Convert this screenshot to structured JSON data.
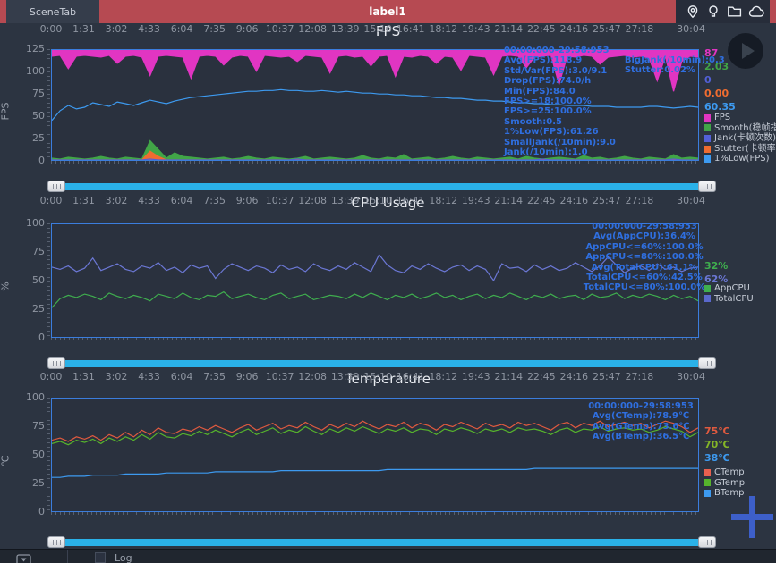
{
  "topbar": {
    "scene_tab": "SceneTab",
    "title": "label1",
    "accent_red": "#b64a52",
    "icons": [
      "location-icon",
      "bulb-icon",
      "folder-icon",
      "cloud-icon"
    ]
  },
  "bottombar": {
    "log_label": "Log"
  },
  "time_labels": [
    "0:00",
    "1:31",
    "3:02",
    "4:33",
    "6:04",
    "7:35",
    "9:06",
    "10:37",
    "12:08",
    "13:39",
    "15:10",
    "16:41",
    "18:12",
    "19:43",
    "21:14",
    "22:45",
    "24:16",
    "25:47",
    "27:18",
    "30:04"
  ],
  "charts": [
    {
      "title": "FPS",
      "unit": "FPS",
      "yticks": [
        "125",
        "100",
        "75",
        "50",
        "25",
        "0"
      ],
      "stats_col1": [
        "00:00:000-29:58:953",
        "Avg(FPS):118.9",
        "Std/Var(FPS):3.0/9.1",
        "Drop(FPS):74.0/h",
        "Min(FPS):84.0",
        "FPS>=18:100.0%",
        "FPS>=25:100.0%",
        "Smooth:0.5",
        "1%Low(FPS):61.26",
        "SmallJank(/10min):9.0",
        "Jank(/10min):1.0"
      ],
      "stats_col2": [
        "BigJank(/10min):0.3",
        "Stutter:0.02%"
      ],
      "values": [
        {
          "text": "87",
          "color": "#e135c2"
        },
        {
          "text": "2.03",
          "color": "#41a547"
        },
        {
          "text": "0",
          "color": "#5260d8"
        },
        {
          "text": "0.00",
          "color": "#ef6c30"
        },
        {
          "text": "60.35",
          "color": "#3d9af0"
        }
      ],
      "legend": [
        {
          "label": "FPS",
          "color": "#e135c2"
        },
        {
          "label": "Smooth(稳帧指数)",
          "color": "#41a547"
        },
        {
          "label": "Jank(卡顿次数)",
          "color": "#5260d8"
        },
        {
          "label": "Stutter(卡顿率)",
          "color": "#ef6c30"
        },
        {
          "label": "1%Low(FPS)",
          "color": "#3d9af0"
        }
      ]
    },
    {
      "title": "CPU Usage",
      "unit": "%",
      "yticks": [
        "100",
        "75",
        "50",
        "25",
        "0"
      ],
      "stats_col1": [
        "00:00:000-29:58:953",
        "Avg(AppCPU):36.4%",
        "AppCPU<=60%:100.0%",
        "AppCPU<=80%:100.0%",
        "Avg(TotalCPU):61.1%",
        "TotalCPU<=60%:42.5%",
        "TotalCPU<=80%:100.0%"
      ],
      "values": [
        {
          "text": "32%",
          "color": "#3fae4e"
        },
        {
          "text": "62%",
          "color": "#6b77d4"
        }
      ],
      "legend": [
        {
          "label": "AppCPU",
          "color": "#3fae4e"
        },
        {
          "label": "TotalCPU",
          "color": "#5a68cc"
        }
      ]
    },
    {
      "title": "Temperature",
      "unit": "℃",
      "yticks": [
        "100",
        "75",
        "50",
        "25",
        "0"
      ],
      "stats_col1": [
        "00:00:000-29:58:953",
        "Avg(CTemp):78.9℃",
        "Avg(GTemp):73.6℃",
        "Avg(BTemp):36.5℃"
      ],
      "values": [
        {
          "text": "75℃",
          "color": "#e05a3f"
        },
        {
          "text": "70℃",
          "color": "#84b527"
        },
        {
          "text": "38℃",
          "color": "#3d9af0"
        }
      ],
      "legend": [
        {
          "label": "CTemp",
          "color": "#e8604f"
        },
        {
          "label": "GTemp",
          "color": "#56b32c"
        },
        {
          "label": "BTemp",
          "color": "#3d9af0"
        }
      ]
    }
  ],
  "chart_data": [
    {
      "type": "line",
      "title": "FPS",
      "x_range": [
        "0:00",
        "30:04"
      ],
      "ylim": [
        0,
        125
      ],
      "grid": false,
      "legend_position": "right",
      "series": [
        {
          "name": "FPS",
          "color": "#e135c2",
          "style": "fill-top",
          "values": [
            118,
            119,
            104,
            118,
            119,
            118,
            117,
            119,
            110,
            118,
            119,
            117,
            96,
            118,
            119,
            118,
            117,
            93,
            118,
            119,
            118,
            108,
            117,
            119,
            118,
            101,
            119,
            118,
            117,
            118,
            112,
            119,
            118,
            117,
            99,
            118,
            119,
            117,
            118,
            107,
            118,
            119,
            95,
            118,
            117,
            119,
            118,
            110,
            118,
            117,
            102,
            119,
            118,
            117,
            97,
            118,
            119,
            118,
            105,
            117,
            118,
            119,
            86,
            118,
            117,
            119,
            118,
            109,
            117,
            118,
            119,
            117,
            118,
            116,
            90,
            118,
            78,
            112,
            118,
            117
          ]
        },
        {
          "name": "Smooth",
          "color": "#41a547",
          "style": "fill-bottom",
          "values": [
            2,
            1,
            3,
            2,
            1,
            2,
            4,
            2,
            1,
            3,
            2,
            1,
            22,
            12,
            2,
            8,
            4,
            3,
            2,
            1,
            2,
            3,
            1,
            2,
            4,
            2,
            1,
            3,
            2,
            1,
            2,
            4,
            1,
            2,
            3,
            2,
            1,
            2,
            5,
            2,
            1,
            3,
            2,
            6,
            1,
            2,
            3,
            1,
            2,
            4,
            2,
            1,
            3,
            2,
            1,
            2,
            3,
            1,
            4,
            2,
            1,
            2,
            3,
            2,
            1,
            5,
            2,
            3,
            1,
            2,
            4,
            2,
            1,
            3,
            2,
            1,
            6,
            2,
            3,
            2
          ]
        },
        {
          "name": "Stutter",
          "color": "#ef6c30",
          "style": "fill-bottom",
          "values": [
            0,
            0,
            0,
            0,
            0,
            0,
            0,
            0,
            0,
            0,
            0,
            0,
            10,
            4,
            0,
            0,
            0,
            0,
            0,
            0,
            0,
            0,
            0,
            0,
            0,
            0,
            0,
            0,
            0,
            0,
            0,
            0,
            0,
            0,
            0,
            0,
            0,
            0,
            0,
            0,
            0,
            0,
            0,
            0,
            0,
            0,
            0,
            0,
            0,
            0,
            0,
            0,
            0,
            0,
            0,
            0,
            0,
            0,
            0,
            0,
            0,
            0,
            0,
            0,
            0,
            0,
            0,
            0,
            0,
            0,
            0,
            0,
            0,
            0,
            0,
            0,
            0,
            0,
            0,
            0
          ]
        },
        {
          "name": "Jank",
          "color": "#5260d8",
          "style": "line",
          "values": [
            0,
            0,
            0,
            0,
            0,
            0,
            0,
            0,
            0,
            0,
            0,
            0,
            1,
            0,
            0,
            0,
            0,
            0,
            0,
            0,
            0,
            0,
            0,
            0,
            0,
            0,
            0,
            0,
            0,
            0,
            1,
            0,
            0,
            0,
            0,
            0,
            0,
            0,
            0,
            0,
            0,
            0,
            0,
            0,
            0,
            0,
            0,
            0,
            0,
            0,
            0,
            0,
            0,
            0,
            0,
            0,
            0,
            0,
            0,
            0,
            1,
            0,
            0,
            0,
            0,
            0,
            0,
            0,
            0,
            0,
            0,
            0,
            0,
            0,
            0,
            0,
            1,
            0,
            0,
            0
          ]
        },
        {
          "name": "1%Low(FPS)",
          "color": "#3d9af0",
          "style": "line",
          "values": [
            45,
            56,
            62,
            58,
            60,
            65,
            63,
            61,
            66,
            64,
            62,
            65,
            68,
            66,
            64,
            67,
            69,
            71,
            72,
            73,
            74,
            75,
            76,
            77,
            78,
            78,
            79,
            79,
            80,
            79,
            79,
            78,
            78,
            79,
            78,
            77,
            78,
            77,
            76,
            76,
            75,
            75,
            74,
            74,
            73,
            73,
            72,
            71,
            71,
            70,
            70,
            69,
            68,
            68,
            67,
            67,
            66,
            65,
            65,
            64,
            64,
            63,
            63,
            62,
            62,
            62,
            61,
            61,
            61,
            60,
            60,
            60,
            60,
            61,
            61,
            60,
            59,
            60,
            61,
            60
          ]
        }
      ]
    },
    {
      "type": "line",
      "title": "CPU Usage",
      "x_range": [
        "0:00",
        "30:04"
      ],
      "ylim": [
        0,
        100
      ],
      "grid": false,
      "legend_position": "right",
      "series": [
        {
          "name": "TotalCPU",
          "color": "#6b77d4",
          "style": "line",
          "values": [
            62,
            60,
            63,
            58,
            61,
            70,
            59,
            62,
            65,
            60,
            58,
            63,
            61,
            66,
            59,
            62,
            57,
            64,
            61,
            63,
            52,
            60,
            65,
            62,
            59,
            63,
            61,
            57,
            64,
            60,
            62,
            58,
            65,
            61,
            59,
            63,
            60,
            66,
            62,
            58,
            73,
            64,
            59,
            57,
            63,
            60,
            65,
            61,
            58,
            62,
            64,
            59,
            63,
            60,
            50,
            65,
            61,
            62,
            58,
            64,
            60,
            63,
            59,
            61,
            66,
            62,
            58,
            63,
            71,
            64,
            57,
            61,
            63,
            59,
            65,
            60,
            62,
            58,
            61,
            62
          ]
        },
        {
          "name": "AppCPU",
          "color": "#3fae4e",
          "style": "line",
          "values": [
            26,
            34,
            37,
            35,
            38,
            36,
            33,
            39,
            36,
            34,
            37,
            35,
            32,
            38,
            36,
            34,
            39,
            35,
            33,
            37,
            36,
            40,
            34,
            36,
            38,
            35,
            33,
            37,
            39,
            34,
            36,
            38,
            33,
            35,
            37,
            36,
            34,
            38,
            35,
            39,
            36,
            33,
            37,
            35,
            38,
            34,
            36,
            39,
            35,
            37,
            33,
            36,
            38,
            34,
            37,
            35,
            39,
            36,
            33,
            37,
            35,
            38,
            34,
            36,
            37,
            33,
            38,
            35,
            36,
            39,
            34,
            37,
            35,
            38,
            36,
            33,
            37,
            34,
            36,
            32
          ]
        }
      ]
    },
    {
      "type": "line",
      "title": "Temperature",
      "x_range": [
        "0:00",
        "30:04"
      ],
      "ylim": [
        0,
        100
      ],
      "grid": false,
      "legend_position": "right",
      "series": [
        {
          "name": "BTemp",
          "color": "#3d9af0",
          "style": "line",
          "values": [
            30,
            30,
            31,
            31,
            31,
            32,
            32,
            32,
            32,
            33,
            33,
            33,
            33,
            33,
            34,
            34,
            34,
            34,
            34,
            34,
            35,
            35,
            35,
            35,
            35,
            35,
            35,
            35,
            36,
            36,
            36,
            36,
            36,
            36,
            36,
            36,
            36,
            36,
            36,
            36,
            36,
            37,
            37,
            37,
            37,
            37,
            37,
            37,
            37,
            37,
            37,
            37,
            37,
            37,
            37,
            37,
            37,
            37,
            37,
            38,
            38,
            38,
            38,
            38,
            38,
            38,
            38,
            38,
            38,
            38,
            38,
            38,
            38,
            38,
            38,
            38,
            38,
            38,
            38,
            38
          ]
        },
        {
          "name": "GTemp",
          "color": "#56b32c",
          "style": "line",
          "values": [
            60,
            62,
            59,
            63,
            61,
            64,
            60,
            65,
            62,
            66,
            63,
            68,
            64,
            70,
            66,
            65,
            69,
            67,
            71,
            68,
            72,
            69,
            66,
            70,
            73,
            68,
            71,
            74,
            69,
            72,
            70,
            75,
            71,
            68,
            73,
            70,
            74,
            71,
            75,
            72,
            69,
            73,
            71,
            74,
            70,
            73,
            72,
            68,
            73,
            71,
            74,
            72,
            69,
            73,
            71,
            73,
            70,
            74,
            72,
            73,
            71,
            68,
            72,
            74,
            70,
            73,
            72,
            75,
            71,
            73,
            74,
            72,
            73,
            70,
            72,
            75,
            73,
            71,
            66,
            70
          ]
        },
        {
          "name": "CTemp",
          "color": "#e05a3f",
          "style": "line",
          "values": [
            63,
            65,
            62,
            66,
            64,
            67,
            63,
            68,
            65,
            70,
            66,
            72,
            68,
            74,
            70,
            69,
            73,
            71,
            75,
            72,
            76,
            73,
            70,
            74,
            77,
            72,
            75,
            78,
            73,
            76,
            74,
            79,
            75,
            72,
            77,
            74,
            78,
            75,
            80,
            76,
            73,
            77,
            75,
            79,
            74,
            78,
            76,
            72,
            77,
            75,
            79,
            76,
            73,
            78,
            75,
            77,
            74,
            79,
            76,
            78,
            75,
            72,
            77,
            79,
            74,
            78,
            76,
            80,
            75,
            77,
            79,
            76,
            78,
            74,
            77,
            80,
            78,
            75,
            70,
            74
          ]
        }
      ]
    }
  ]
}
